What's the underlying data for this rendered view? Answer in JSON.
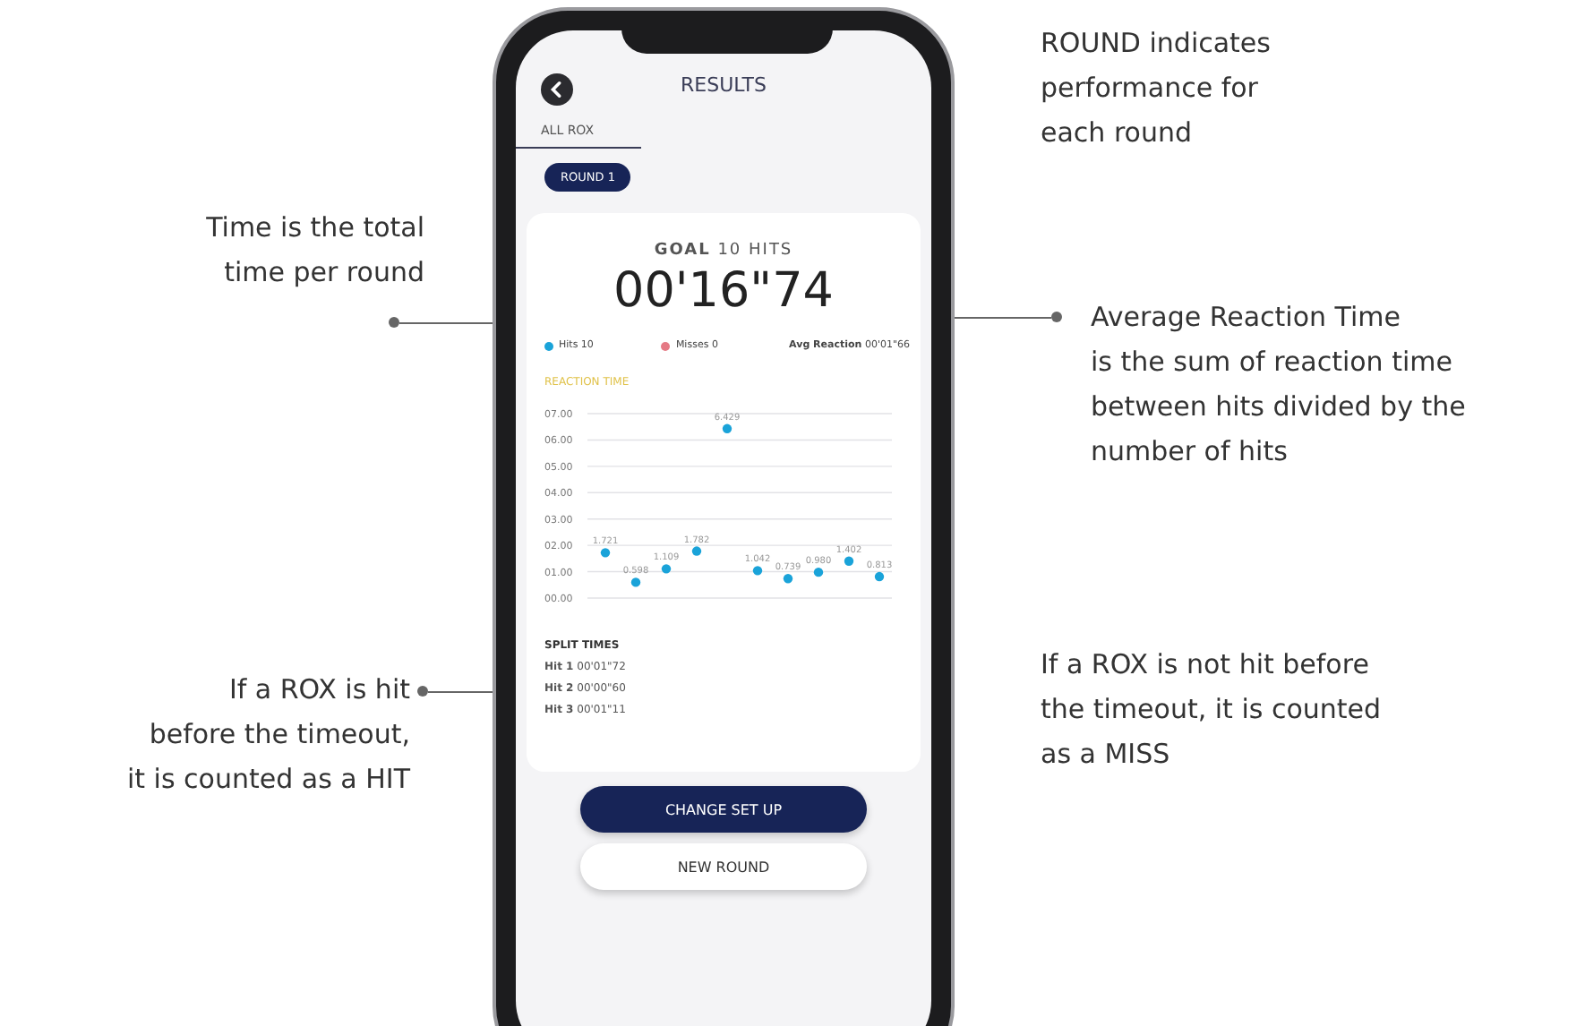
{
  "annotations_left": [
    {
      "text": "Time is the total\ntime per round",
      "leader": true
    },
    {
      "text": "If a ROX is hit\nbefore the timeout,\nit is counted as a HIT",
      "leader": true
    }
  ],
  "screen": {
    "title": "RESULTS",
    "tabs": [
      {
        "label": "ALL ROX",
        "selected": true
      }
    ],
    "round_chip": "ROUND 1",
    "goal": {
      "label": "GOAL",
      "value": "10 HITS"
    },
    "total_time": "00'16\"74",
    "legend": [
      {
        "label": "Hits 10",
        "color": "#1aa3d9"
      },
      {
        "label": "Misses 0",
        "color": "#e57a85"
      }
    ],
    "avg_reaction": {
      "label": "Avg Reaction",
      "value": "00'01\"66"
    },
    "chart_title": "REACTION TIME",
    "chart_data": {
      "type": "scatter",
      "series": [
        {
          "color": "#1aa3d9",
          "values": [
            1.721,
            0.598,
            1.109,
            1.782,
            6.429,
            1.042,
            0.739,
            0.98,
            1.402,
            0.813
          ]
        }
      ],
      "value_labels": [
        "1.721",
        "0.598",
        "1.109",
        "1.782",
        "6.429",
        "1.042",
        "0.739",
        "0.980",
        "1.402",
        "0.813"
      ],
      "grid": true,
      "ylim": [
        0,
        7
      ],
      "yticks": [
        {
          "value": 0,
          "label": "00.00"
        },
        {
          "value": 1,
          "label": "01.00"
        },
        {
          "value": 2,
          "label": "02.00"
        },
        {
          "value": 3,
          "label": "03.00"
        },
        {
          "value": 4,
          "label": "04.00"
        },
        {
          "value": 5,
          "label": "05.00"
        },
        {
          "value": 6,
          "label": "06.00"
        },
        {
          "value": 7,
          "label": "07.00"
        }
      ]
    },
    "split_times_title": "SPLIT TIMES",
    "split_times": [
      "**Hit 1** 00'01\"72",
      "**Hit 2** 00'00\"60",
      "**Hit 3** 00'01\"11"
    ],
    "buttons": [
      {
        "label": "CHANGE SET UP",
        "kind": "primary"
      },
      {
        "label": "NEW ROUND",
        "kind": "secondary"
      }
    ]
  },
  "annotations_right": [
    {
      "text": "ROUND indicates\nperformance for\neach round",
      "leader": false
    },
    {
      "text": "Average Reaction Time\nis the sum of reaction time\nbetween hits divided by the\nnumber of hits",
      "leader": true
    },
    {
      "text": "If a ROX is not hit before\nthe timeout, it is counted\nas a MISS",
      "leader": false
    }
  ]
}
